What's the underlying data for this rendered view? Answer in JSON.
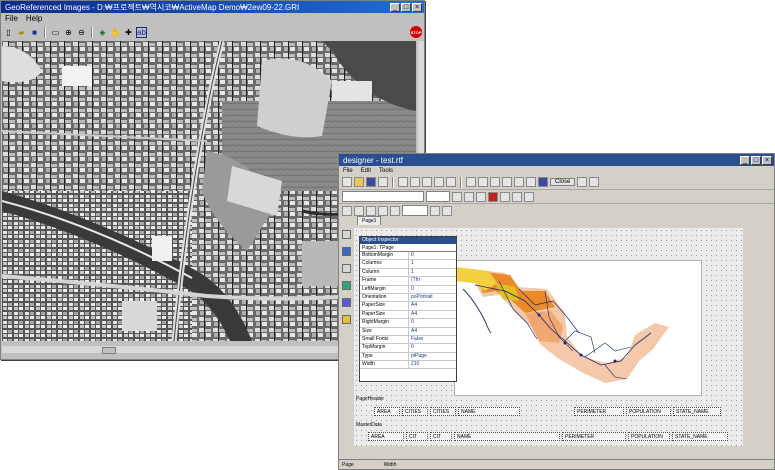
{
  "geo_window": {
    "title": "GeoReferenced Images - D:₩프로젝트₩역시코₩ActiveMap Demo₩2ew09-22.GRI",
    "menu": [
      "File",
      "Help"
    ],
    "toolbar_icons": [
      "new-icon",
      "open-icon",
      "save-icon",
      "print-icon",
      "zoom-in-icon",
      "zoom-out-icon",
      "identify-icon",
      "pan-hand-icon",
      "center-icon",
      "label-icon"
    ],
    "stop_label": "STOP",
    "title_buttons": [
      "_",
      "□",
      "×"
    ]
  },
  "designer_window": {
    "title": "designer - test.rtf",
    "menu": [
      "File",
      "Edit",
      "Tools"
    ],
    "toolbar_close_label": "Close",
    "tab_label": "Page1",
    "property_panel": {
      "title": "Object Inspector",
      "selected": "Page1: TPage",
      "rows": [
        {
          "key": "BottomMargin",
          "value": "0"
        },
        {
          "key": "Columns",
          "value": "1"
        },
        {
          "key": "Column",
          "value": "1"
        },
        {
          "key": "Frame",
          "value": "(Tfrr"
        },
        {
          "key": "LeftMargin",
          "value": "0"
        },
        {
          "key": "Orientation",
          "value": "poPortrait"
        },
        {
          "key": "PaperSize",
          "value": "A4"
        },
        {
          "key": "PaperSize",
          "value": "A4"
        },
        {
          "key": "RightMargin",
          "value": "0"
        },
        {
          "key": "Size",
          "value": "A4"
        },
        {
          "key": "Small Fonts",
          "value": "False"
        },
        {
          "key": "TopMargin",
          "value": "0"
        },
        {
          "key": "Type",
          "value": "ptPage"
        },
        {
          "key": "Width",
          "value": "210"
        }
      ]
    },
    "bands": [
      {
        "label": "PageHeader",
        "fields": [
          "AREA",
          "CITIES",
          "CITIES",
          "NAME",
          "PERIMETER",
          "POPULATION",
          "STATE_NAME"
        ]
      },
      {
        "label": "MasterData",
        "fields": [
          "AREA",
          "CIT",
          "CIT",
          "NAME",
          "PERIMETER",
          "POPULATION",
          "STATE_NAME"
        ]
      }
    ],
    "status": [
      "Page",
      "Width"
    ]
  }
}
